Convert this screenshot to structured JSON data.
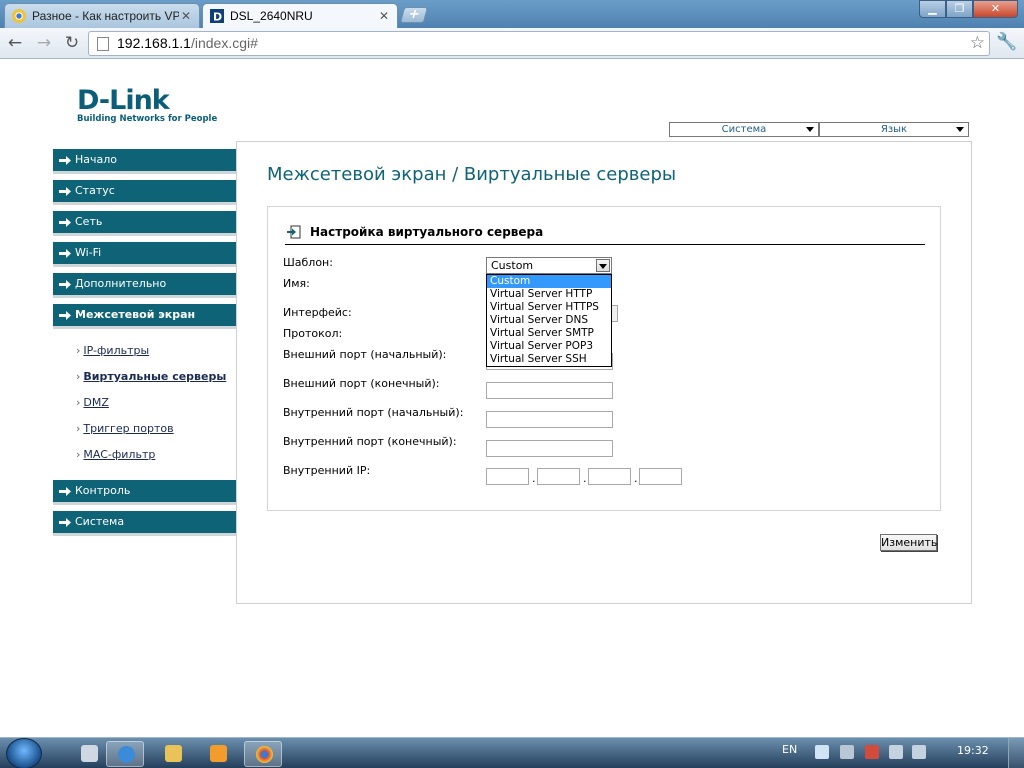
{
  "browser": {
    "tabs": [
      {
        "label": "Разное - Как настроить VP",
        "active": false
      },
      {
        "label": "DSL_2640NRU",
        "active": true
      }
    ],
    "url_host": "192.168.1.1",
    "url_path": "/index.cgi#"
  },
  "header": {
    "logo": "D-Link",
    "tagline": "Building Networks for People",
    "dropdowns": [
      "Система",
      "Язык"
    ]
  },
  "menu": {
    "items": [
      "Начало",
      "Статус",
      "Сеть",
      "Wi-Fi",
      "Дополнительно",
      "Межсетевой экран"
    ],
    "subitems": [
      "IP-фильтры",
      "Виртуальные серверы",
      "DMZ",
      "Триггер портов",
      "MAC-фильтр"
    ],
    "bottom_items": [
      "Контроль",
      "Система"
    ],
    "active_item": "Межсетевой экран",
    "active_subitem": "Виртуальные серверы"
  },
  "page": {
    "title": "Межсетевой экран / Виртуальные серверы",
    "section": "Настройка виртуального сервера",
    "labels": {
      "template": "Шаблон:",
      "name": "Имя:",
      "interface": "Интерфейс:",
      "protocol": "Протокол:",
      "ext_start": "Внешний порт (начальный):",
      "ext_end": "Внешний порт (конечный):",
      "int_start": "Внутренний порт (начальный):",
      "int_end": "Внутренний порт (конечный):",
      "int_ip": "Внутренний IP:"
    },
    "ip_separators": [
      ".",
      ".",
      "."
    ],
    "template_value": "Custom",
    "template_options": [
      "Custom",
      "Virtual Server HTTP",
      "Virtual Server HTTPS",
      "Virtual Server DNS",
      "Virtual Server SMTP",
      "Virtual Server POP3",
      "Virtual Server SSH"
    ],
    "apply_button": "Изменить"
  },
  "taskbar": {
    "lang": "EN",
    "time": "19:32"
  },
  "colors": {
    "dlink_teal": "#0f6377",
    "link": "#1a2b52",
    "selection": "#3399ff"
  }
}
